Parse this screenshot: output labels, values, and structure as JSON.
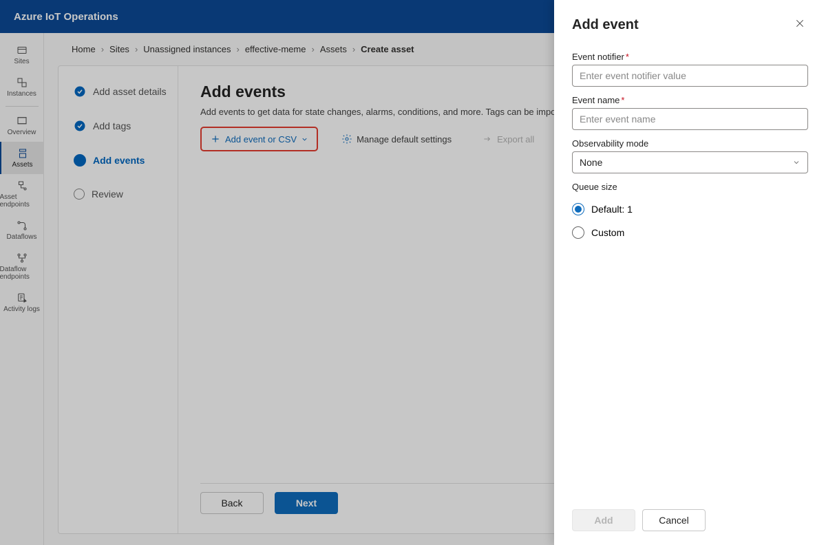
{
  "header": {
    "title": "Azure IoT Operations"
  },
  "rail": [
    {
      "label": "Sites",
      "icon": "sites"
    },
    {
      "label": "Instances",
      "icon": "instances"
    },
    {
      "label": "Overview",
      "icon": "overview"
    },
    {
      "label": "Assets",
      "icon": "assets",
      "active": true
    },
    {
      "label": "Asset endpoints",
      "icon": "asset-endpoints"
    },
    {
      "label": "Dataflows",
      "icon": "dataflows"
    },
    {
      "label": "Dataflow endpoints",
      "icon": "dataflow-endpoints"
    },
    {
      "label": "Activity logs",
      "icon": "activity-logs"
    }
  ],
  "breadcrumb": [
    "Home",
    "Sites",
    "Unassigned instances",
    "effective-meme",
    "Assets",
    "Create asset"
  ],
  "wizard": {
    "steps": [
      {
        "label": "Add asset details",
        "state": "done"
      },
      {
        "label": "Add tags",
        "state": "done"
      },
      {
        "label": "Add events",
        "state": "active"
      },
      {
        "label": "Review",
        "state": "todo"
      }
    ]
  },
  "main": {
    "title": "Add events",
    "desc": "Add events to get data for state changes, alarms, conditions, and more. Tags can be imported from a CSV file or added manually.",
    "toolbar": {
      "add_label": "Add event or CSV",
      "manage_label": "Manage default settings",
      "export_label": "Export all"
    },
    "footer": {
      "back": "Back",
      "next": "Next"
    }
  },
  "panel": {
    "title": "Add event",
    "fields": {
      "notifier_label": "Event notifier",
      "notifier_placeholder": "Enter event notifier value",
      "name_label": "Event name",
      "name_placeholder": "Enter event name",
      "obs_label": "Observability mode",
      "obs_value": "None",
      "queue_label": "Queue size",
      "queue_options": [
        "Default: 1",
        "Custom"
      ],
      "queue_selected": 0
    },
    "footer": {
      "add": "Add",
      "cancel": "Cancel"
    }
  }
}
